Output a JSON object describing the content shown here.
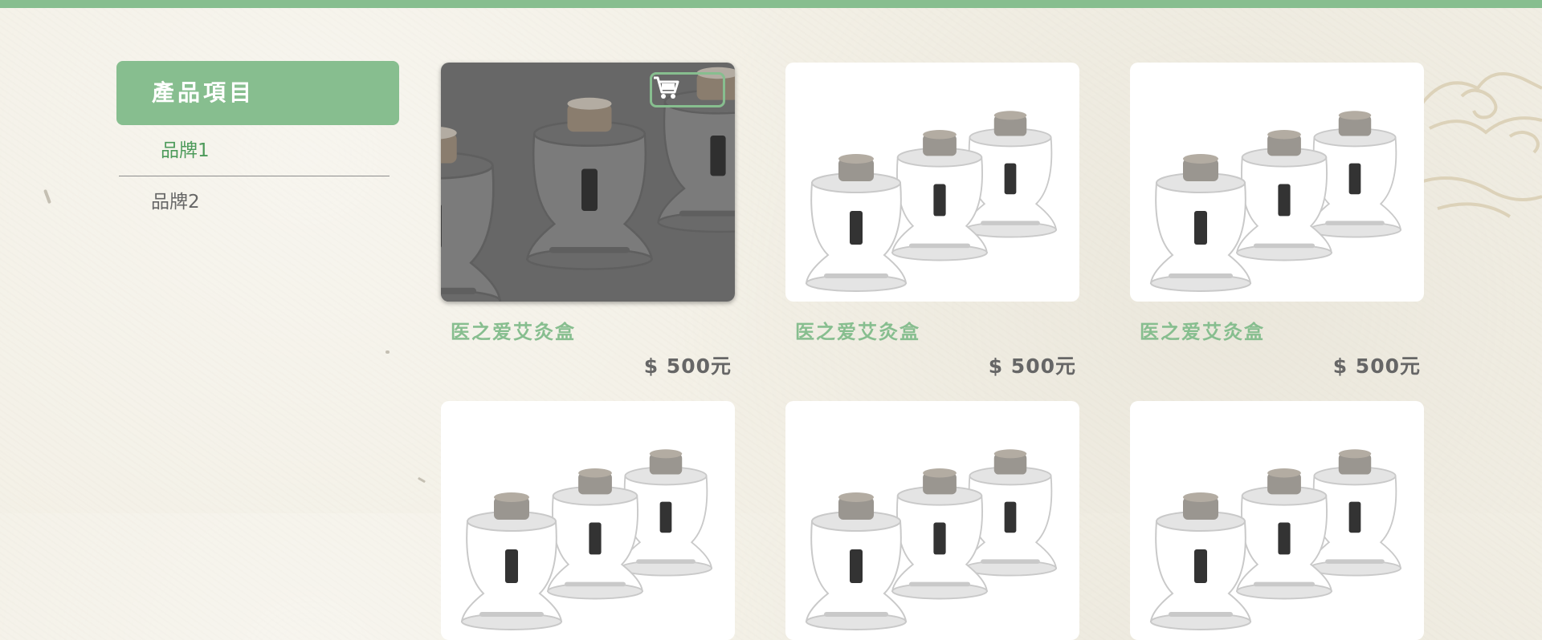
{
  "sidebar": {
    "header": "產品項目",
    "items": [
      {
        "label": "品牌1",
        "active": true
      },
      {
        "label": "品牌2",
        "active": false
      }
    ]
  },
  "products": [
    {
      "name": "医之爱艾灸盒",
      "price": "$ 500元",
      "hovered": true
    },
    {
      "name": "医之爱艾灸盒",
      "price": "$ 500元",
      "hovered": false
    },
    {
      "name": "医之爱艾灸盒",
      "price": "$ 500元",
      "hovered": false
    },
    {
      "name": "",
      "price": "",
      "hovered": false
    },
    {
      "name": "",
      "price": "",
      "hovered": false
    },
    {
      "name": "",
      "price": "",
      "hovered": false
    }
  ],
  "icons": {
    "cart": "cart-icon",
    "product": "moxibustion-cups-image"
  },
  "colors": {
    "accent": "#87be8f",
    "name_text": "#87be8f",
    "price_text": "#666666",
    "overlay": "#5a5a5a"
  }
}
